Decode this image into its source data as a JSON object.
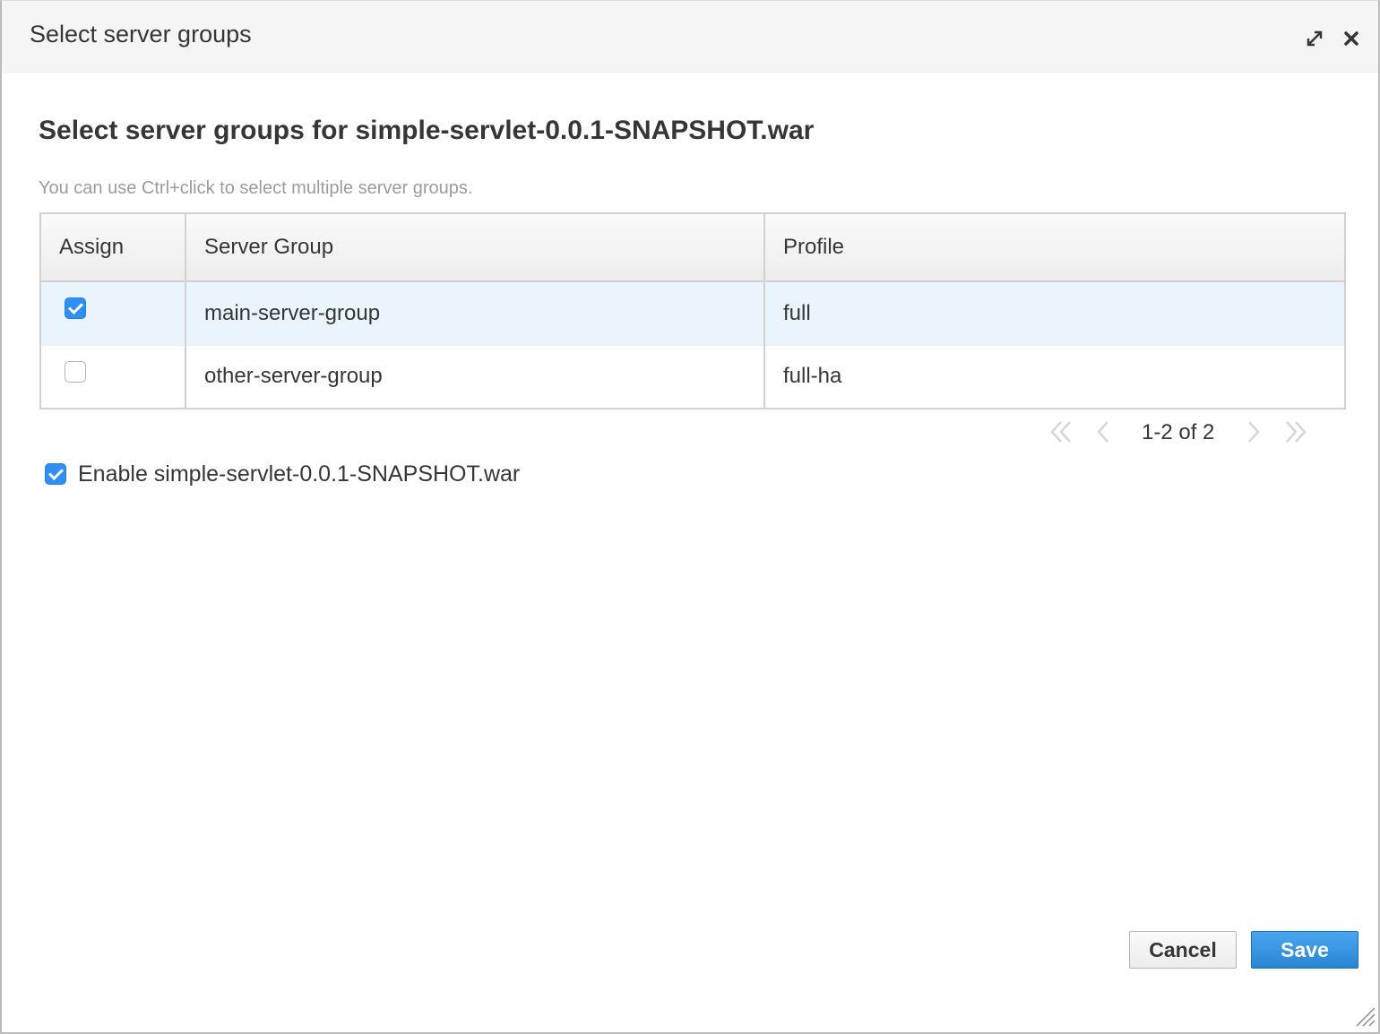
{
  "dialog": {
    "title": "Select server groups",
    "heading": "Select server groups for simple-servlet-0.0.1-SNAPSHOT.war",
    "hint": "You can use Ctrl+click to select multiple server groups."
  },
  "table": {
    "columns": [
      "Assign",
      "Server Group",
      "Profile"
    ],
    "rows": [
      {
        "assigned": true,
        "server_group": "main-server-group",
        "profile": "full"
      },
      {
        "assigned": false,
        "server_group": "other-server-group",
        "profile": "full-ha"
      }
    ]
  },
  "pager": {
    "info": "1-2 of 2"
  },
  "enable": {
    "label": "Enable simple-servlet-0.0.1-SNAPSHOT.war",
    "checked": true
  },
  "buttons": {
    "cancel": "Cancel",
    "save": "Save"
  },
  "colors": {
    "accent": "#2f8ff4",
    "selected_row": "#e9f4fc",
    "hint_text": "#9c9c9c"
  },
  "icons": [
    "maximize-icon",
    "close-icon",
    "first-page-icon",
    "prev-page-icon",
    "next-page-icon",
    "last-page-icon",
    "checkmark-icon",
    "resize-grip-icon"
  ]
}
